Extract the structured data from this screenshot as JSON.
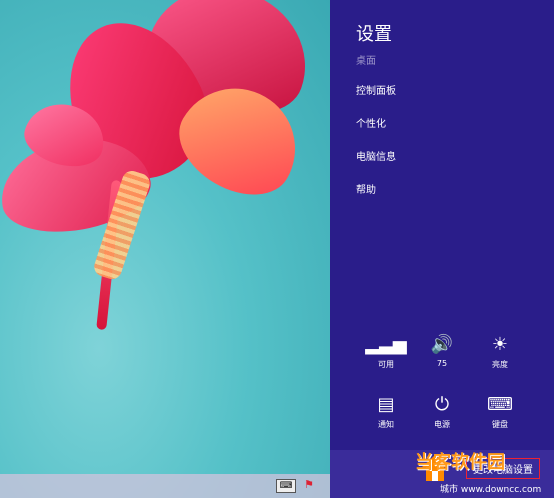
{
  "pane": {
    "title": "设置",
    "subtitle": "桌面",
    "menu": [
      "控制面板",
      "个性化",
      "电脑信息",
      "帮助"
    ],
    "quick": [
      {
        "icon": "network-icon",
        "label": "可用",
        "glyph": "▂▃▅"
      },
      {
        "icon": "volume-icon",
        "label": "75",
        "glyph": "🔊"
      },
      {
        "icon": "brightness-icon",
        "label": "亮度",
        "glyph": "☀"
      },
      {
        "icon": "notifications-icon",
        "label": "通知",
        "glyph": "▤"
      },
      {
        "icon": "power-icon",
        "label": "电源",
        "glyph": "⏻"
      },
      {
        "icon": "keyboard-icon",
        "label": "键盘",
        "glyph": "⌨"
      }
    ],
    "change_pc_settings": "更改电脑设置"
  },
  "taskbar": {
    "keyboard_glyph": "⌨",
    "flag_glyph": "⚑"
  },
  "watermark": {
    "text": "当客软件园",
    "sub": "城市 www.downcc.com"
  }
}
